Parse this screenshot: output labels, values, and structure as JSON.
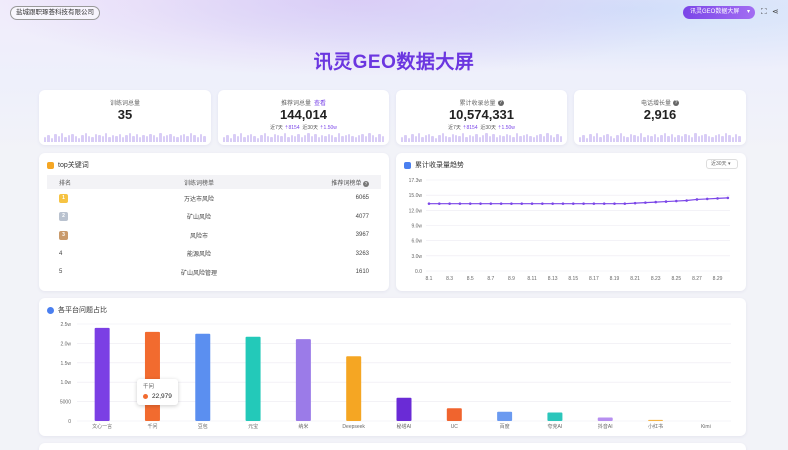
{
  "header": {
    "company": "盐城跟职琢荟科技有限公司",
    "selector": "讯灵GEO数据大屏",
    "title": "讯灵GEO数据大屏",
    "accent": "#6b36e0"
  },
  "stats": [
    {
      "label": "训练词总量",
      "value": "35",
      "link": "",
      "sub": null
    },
    {
      "label": "推荐词总量",
      "link": "查看",
      "value": "144,014",
      "sub": {
        "d7_label": "近7天",
        "d7": "8154",
        "d30_label": "近30天",
        "d30": "1.50w"
      }
    },
    {
      "label": "累计收录总量",
      "link": "",
      "value": "10,574,331",
      "sub": {
        "d7_label": "近7天",
        "d7": "8154",
        "d30_label": "近30天",
        "d30": "1.50w"
      }
    },
    {
      "label": "电话增长量",
      "link": "",
      "value": "2,916",
      "sub": null
    }
  ],
  "keywords": {
    "title": "top关键词",
    "headers": [
      "排名",
      "训练词榜单",
      "推荐词榜单"
    ],
    "rows": [
      {
        "rank": "1",
        "name": "万达市风险",
        "count": "6065"
      },
      {
        "rank": "2",
        "name": "矿山风险",
        "count": "4077"
      },
      {
        "rank": "3",
        "name": "风险市",
        "count": "3967"
      },
      {
        "rank": "4",
        "name": "能源风险",
        "count": "3263"
      },
      {
        "rank": "5",
        "name": "矿山风险管理",
        "count": "1610"
      }
    ]
  },
  "trend": {
    "title": "累计收录量趋势",
    "range": "近30天",
    "color": "#7b46e8",
    "yticks": [
      "17.3w",
      "15.0w",
      "12.0w",
      "9.0w",
      "6.0w",
      "3.0w",
      "0.0"
    ],
    "xticks": [
      "8.1",
      "8.3",
      "8.5",
      "8.7",
      "8.9",
      "8.11",
      "8.13",
      "8.15",
      "8.17",
      "8.19",
      "8.21",
      "8.23",
      "8.25",
      "8.27",
      "8.29"
    ]
  },
  "platform": {
    "title": "各平台问题占比",
    "tooltip": {
      "label": "千问",
      "value": "22,979"
    }
  },
  "chart_data": [
    {
      "type": "line",
      "title": "累计收录量趋势",
      "xlabel": "",
      "ylabel": "",
      "ylim": [
        0,
        173000
      ],
      "x": [
        "8.1",
        "8.2",
        "8.3",
        "8.4",
        "8.5",
        "8.6",
        "8.7",
        "8.8",
        "8.9",
        "8.10",
        "8.11",
        "8.12",
        "8.13",
        "8.14",
        "8.15",
        "8.16",
        "8.17",
        "8.18",
        "8.19",
        "8.20",
        "8.21",
        "8.22",
        "8.23",
        "8.24",
        "8.25",
        "8.26",
        "8.27",
        "8.28",
        "8.29",
        "8.30"
      ],
      "series": [
        {
          "values": [
            128000,
            128000,
            128000,
            128000,
            128000,
            128000,
            128000,
            128000,
            128000,
            128000,
            128000,
            128000,
            128000,
            128000,
            128000,
            128000,
            128000,
            128000,
            128000,
            128000,
            129000,
            130000,
            131000,
            132000,
            133000,
            134000,
            136000,
            137000,
            138000,
            139000
          ]
        }
      ]
    },
    {
      "type": "bar",
      "title": "各平台问题占比",
      "xlabel": "",
      "ylabel": "",
      "ylim": [
        0,
        25000
      ],
      "yticks": [
        "0",
        "5000",
        "1.0w",
        "1.5w",
        "2.0w",
        "2.5w"
      ],
      "categories": [
        "文心一言",
        "千问",
        "豆包",
        "元宝",
        "纳米",
        "Deepseek",
        "秘塔AI",
        "UC",
        "百度",
        "夸克AI",
        "抖音AI",
        "小红书",
        "Kimi"
      ],
      "values": [
        24000,
        22979,
        22500,
        21700,
        21100,
        16700,
        6000,
        3300,
        2400,
        2200,
        900,
        300,
        0
      ],
      "colors": [
        "#7b3fe4",
        "#f26b2f",
        "#5b8ff0",
        "#23c9b9",
        "#9b7be8",
        "#f5a623",
        "#6a2bd6",
        "#f0642e",
        "#6b9af0",
        "#2bc6bb",
        "#b78ff0",
        "#f5b445",
        "#7b3fe4"
      ]
    }
  ]
}
